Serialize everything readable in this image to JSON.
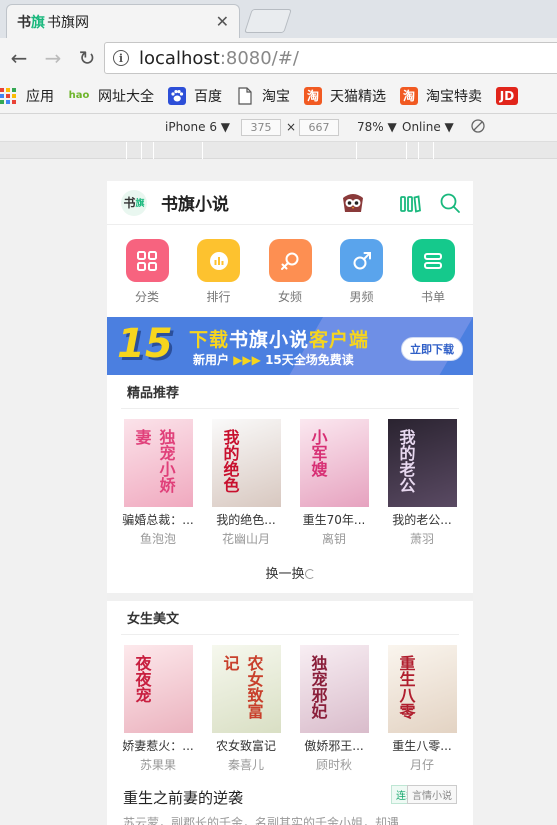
{
  "browser": {
    "tab_title": "书旗网",
    "tab_favicon": "书旗",
    "close_glyph": "✕",
    "back_glyph": "←",
    "forward_glyph": "→",
    "reload_glyph": "↻",
    "url_host": "localhost",
    "url_rest": ":8080/#/",
    "bookmarks": [
      {
        "label": "应用",
        "icon": "apps-icon"
      },
      {
        "label": "网址大全",
        "icon": "hao-icon",
        "icon_text": "hao"
      },
      {
        "label": "百度",
        "icon": "baidu-paw-icon"
      },
      {
        "label": "淘宝",
        "icon": "page-icon"
      },
      {
        "label": "天猫精选",
        "icon": "tao-icon",
        "icon_text": "淘"
      },
      {
        "label": "淘宝特卖",
        "icon": "tao-icon",
        "icon_text": "淘"
      },
      {
        "label": "JD",
        "icon": "jd-icon"
      }
    ]
  },
  "device_toolbar": {
    "device": "iPhone 6",
    "width": "375",
    "times": "×",
    "height": "667",
    "zoom": "78%",
    "network": "Online",
    "caret": "▼"
  },
  "app": {
    "logo_text": "书",
    "logo_sub": "旗",
    "brand": "书旗小说",
    "categories": [
      {
        "label": "分类",
        "color": "#f7637f",
        "icon": "grid-icon"
      },
      {
        "label": "排行",
        "color": "#fdc22f",
        "icon": "rank-icon"
      },
      {
        "label": "女频",
        "color": "#fd8f52",
        "icon": "female-icon"
      },
      {
        "label": "男频",
        "color": "#5aa4ec",
        "icon": "male-icon"
      },
      {
        "label": "书单",
        "color": "#15c98c",
        "icon": "booklist-icon"
      }
    ],
    "banner": {
      "number": "15",
      "line1_a": "下载",
      "line1_b": "书旗小说",
      "line1_c": "客户端",
      "line2_a": "新用户",
      "line2_arrows": "▶▶▶",
      "line2_b": "15天全场免费读",
      "button": "立即下载"
    },
    "recommend": {
      "title": "精品推荐",
      "books": [
        {
          "title": "骗婚总裁：...",
          "author": "鱼泡泡",
          "cover_text": "独宠小娇妻",
          "bg": "#f3c9d4",
          "fg": "#e0407a"
        },
        {
          "title": "我的绝色...",
          "author": "花幽山月",
          "cover_text": "我的绝色",
          "bg": "#f2ece6",
          "fg": "#c8102e"
        },
        {
          "title": "重生70年...",
          "author": "离钥",
          "cover_text": "小军嫂",
          "bg": "#f6d7e6",
          "fg": "#d72f74"
        },
        {
          "title": "我的老公...",
          "author": "萧羽",
          "cover_text": "我的老公",
          "bg": "#3a2f3e",
          "fg": "#e8d9f0"
        }
      ],
      "refresh": "换一换"
    },
    "female": {
      "title": "女生美文",
      "books": [
        {
          "title": "娇妻惹火：...",
          "author": "苏果果",
          "cover_text": "夜夜宠",
          "bg": "#f5d8dd",
          "fg": "#c81e3f"
        },
        {
          "title": "农女致富记",
          "author": "秦喜儿",
          "cover_text": "农女致富记",
          "bg": "#eef2e4",
          "fg": "#c8402c"
        },
        {
          "title": "傲娇邪王...",
          "author": "顾时秋",
          "cover_text": "独宠邪妃",
          "bg": "#efe3ea",
          "fg": "#8a1e3a"
        },
        {
          "title": "重生八零...",
          "author": "月仔",
          "cover_text": "重生八零",
          "bg": "#f4eee6",
          "fg": "#b01e2e"
        }
      ]
    },
    "feature": {
      "title": "重生之前妻的逆袭",
      "desc": "苏云蒙，副郡长的千金，名副其实的千金小姐，却遇...",
      "tag1": "连载",
      "tag2": "言情小说"
    }
  }
}
